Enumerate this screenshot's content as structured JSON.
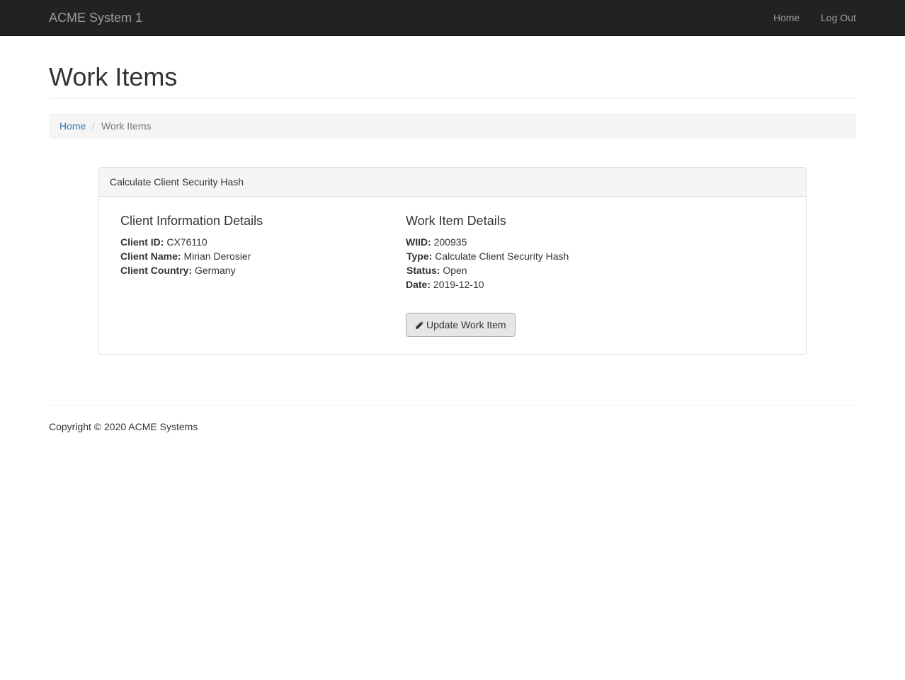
{
  "navbar": {
    "brand": "ACME System 1",
    "links": [
      {
        "label": "Home"
      },
      {
        "label": "Log Out"
      }
    ]
  },
  "page": {
    "title": "Work Items"
  },
  "breadcrumb": {
    "home": "Home",
    "separator": "/",
    "current": "Work Items"
  },
  "panel": {
    "heading": "Calculate Client Security Hash",
    "client": {
      "title": "Client Information Details",
      "fields": [
        {
          "label": "Client ID:",
          "value": "CX76110"
        },
        {
          "label": "Client Name:",
          "value": "Mirian Derosier"
        },
        {
          "label": "Client Country:",
          "value": "Germany"
        }
      ]
    },
    "work_item": {
      "title": "Work Item Details",
      "fields": [
        {
          "label": "WIID:",
          "value": "200935"
        },
        {
          "label": "Type:",
          "value": "Calculate Client Security Hash"
        },
        {
          "label": "Status:",
          "value": "Open"
        },
        {
          "label": "Date:",
          "value": "2019-12-10"
        }
      ]
    },
    "update_button": {
      "label": "Update Work Item",
      "icon": "pencil-icon"
    }
  },
  "footer": {
    "text": "Copyright © 2020 ACME Systems"
  },
  "colors": {
    "navbar_bg": "#222222",
    "navbar_text": "#9d9d9d",
    "link": "#337ab7",
    "panel_border": "#dddddd",
    "heading_bg": "#f5f5f5"
  }
}
